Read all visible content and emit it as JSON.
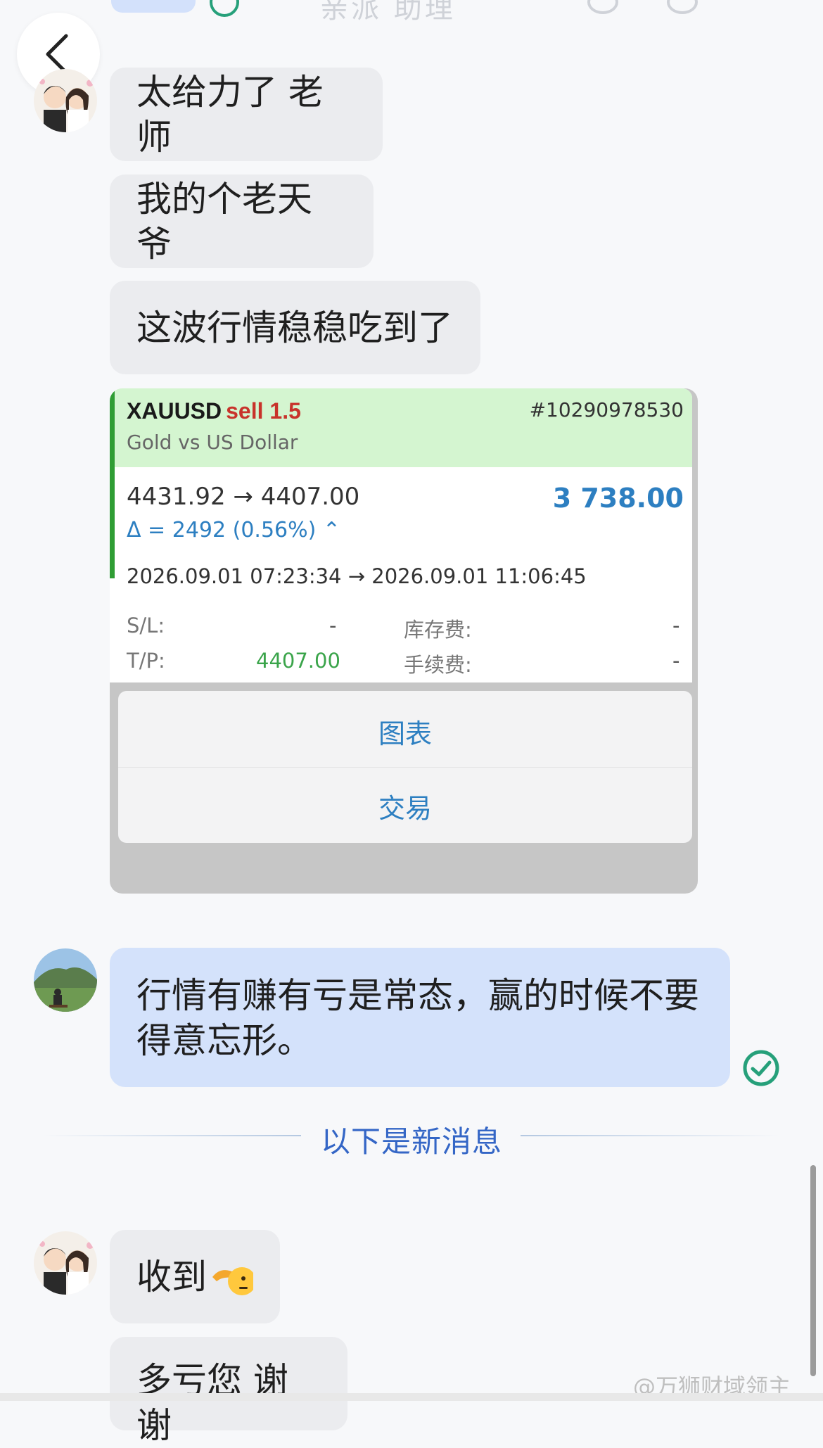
{
  "header": {
    "title": "亲派 助理"
  },
  "messages": [
    {
      "text": "太给力了 老师"
    },
    {
      "text": "我的个老天爷"
    },
    {
      "text": "这波行情稳稳吃到了"
    },
    {
      "text": "行情有赚有亏是常态，赢的时候不要得意忘形。"
    },
    {
      "text": "收到"
    },
    {
      "text": "多亏您 谢谢"
    }
  ],
  "trade_card": {
    "symbol": "XAUUSD",
    "action": "sell 1.5",
    "ticket": "#10290978530",
    "pair_name": "Gold vs US Dollar",
    "prices": "4431.92 → 4407.00",
    "profit": "3 738.00",
    "delta": "Δ = 2492 (0.56%) ⌃",
    "times": "2026.09.01 07:23:34 → 2026.09.01 11:06:45",
    "sl_label": "S/L:",
    "sl_value": "-",
    "tp_label": "T/P:",
    "tp_value": "4407.00",
    "swap_label": "库存费:",
    "swap_value": "-",
    "fee_label": "手续费:",
    "fee_value": "-",
    "menu": [
      "图表",
      "交易"
    ]
  },
  "divider_text": "以下是新消息",
  "watermark": "@万狮财域领主",
  "colors": {
    "incoming_bubble": "#ebecef",
    "outgoing_bubble": "#d4e2fb",
    "accent_blue": "#3466c6",
    "check_green": "#26a07a",
    "loss_red": "#c8332b",
    "profit_blue": "#2d7fc1"
  }
}
